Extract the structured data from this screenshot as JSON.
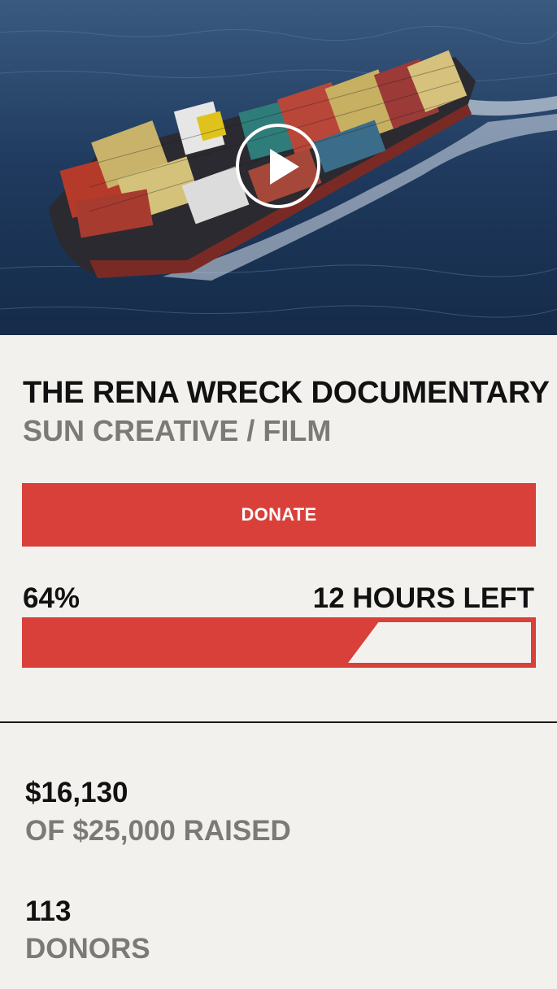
{
  "campaign": {
    "title": "THE RENA WRECK DOCUMENTARY",
    "subtitle": "SUN CREATIVE / FILM"
  },
  "video": {
    "play_icon": "play-icon"
  },
  "donate": {
    "label": "DONATE"
  },
  "progress": {
    "percent_label": "64%",
    "fraction": 0.64,
    "time_left": "12 HOURS LEFT"
  },
  "stats": {
    "raised_value": "$16,130",
    "raised_label": "OF $25,000 RAISED",
    "donors_value": "113",
    "donors_label": "DONORS"
  },
  "colors": {
    "accent": "#d9403a",
    "background": "#f3f1ed",
    "text_primary": "#111111",
    "text_muted": "#7a7a76"
  }
}
